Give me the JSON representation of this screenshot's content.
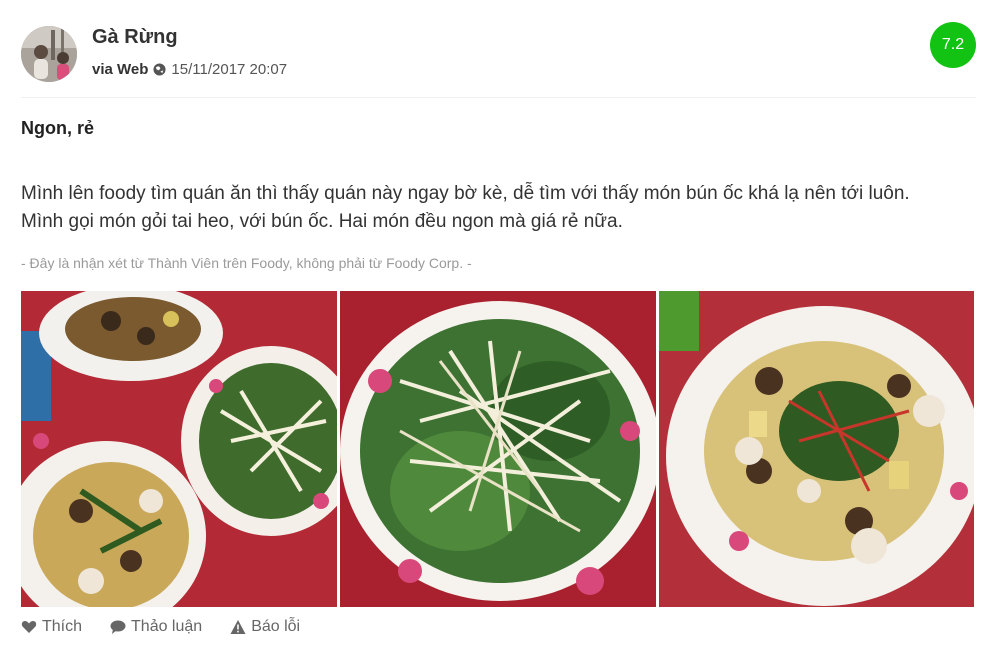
{
  "review": {
    "user": {
      "name": "Gà Rừng",
      "avatar_icon": "user-avatar"
    },
    "via": "via Web",
    "datetime": "15/11/2017 20:07",
    "score": "7.2",
    "score_color": "#12c314",
    "title": "Ngon, rẻ",
    "body_line1": "Mình lên foody tìm quán ăn thì thấy quán này ngay bờ kè, dễ tìm với thấy món bún ốc khá lạ nên tới luôn.",
    "body_line2": "Mình gọi món gỏi tai heo, với bún ốc. Hai món đều ngon mà giá rẻ nữa.",
    "disclaimer": "- Đây là nhận xét từ Thành Viên trên Foody, không phải từ Foody Corp. -"
  },
  "actions": {
    "like": "Thích",
    "discuss": "Thảo luận",
    "report": "Báo lỗi"
  }
}
